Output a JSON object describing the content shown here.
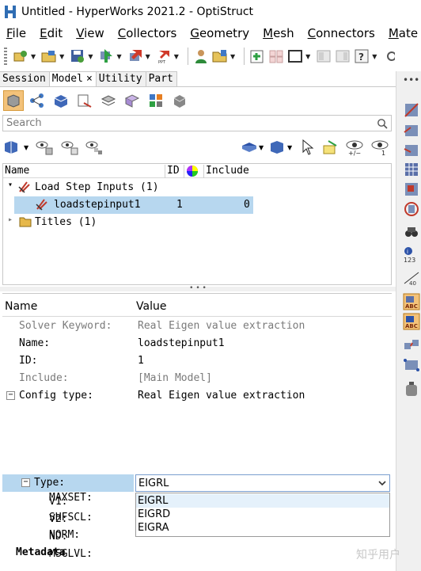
{
  "window": {
    "title": "Untitled - HyperWorks 2021.2 - OptiStruct"
  },
  "menu": [
    "File",
    "Edit",
    "View",
    "Collectors",
    "Geometry",
    "Mesh",
    "Connectors",
    "Mate"
  ],
  "tabs": [
    {
      "label": "Session"
    },
    {
      "label": "Model",
      "close": "×"
    },
    {
      "label": "Utility"
    },
    {
      "label": "Part"
    }
  ],
  "search": {
    "placeholder": "Search"
  },
  "tree": {
    "headers": {
      "name": "Name",
      "id": "ID",
      "include": "Include"
    },
    "rows": [
      {
        "label": "Load Step Inputs (1)"
      },
      {
        "label": "loadstepinput1",
        "id": "1",
        "include": "0"
      },
      {
        "label": "Titles (1)"
      }
    ]
  },
  "splitter": "• • •",
  "properties": {
    "header": {
      "name": "Name",
      "value": "Value"
    },
    "rows": [
      {
        "name": "Solver Keyword:",
        "value": "Real Eigen value extraction"
      },
      {
        "name": "Name:",
        "value": "loadstepinput1"
      },
      {
        "name": "ID:",
        "value": "1"
      },
      {
        "name": "Include:",
        "value": "[Main Model]"
      },
      {
        "name": "Config type:",
        "value": "Real Eigen value extraction"
      },
      {
        "name": "Type:",
        "value": "EIGRL"
      },
      {
        "name": "V1:"
      },
      {
        "name": "V2:"
      },
      {
        "name": "ND:"
      },
      {
        "name": "MSGLVL:"
      },
      {
        "name": "MAXSET:"
      },
      {
        "name": "SHFSCL:"
      },
      {
        "name": "NORM:"
      },
      {
        "name": "Metadata"
      }
    ],
    "type_options": [
      "EIGRL",
      "EIGRD",
      "EIGRA"
    ]
  },
  "eye_labels": {
    "plus_minus": "+/−",
    "one": "1"
  },
  "watermark": "知乎用户",
  "colors": {
    "selection": "#b7d7ef",
    "active_tab_button": "#f3c27a",
    "dropdown_highlight": "#e5f1fb"
  }
}
